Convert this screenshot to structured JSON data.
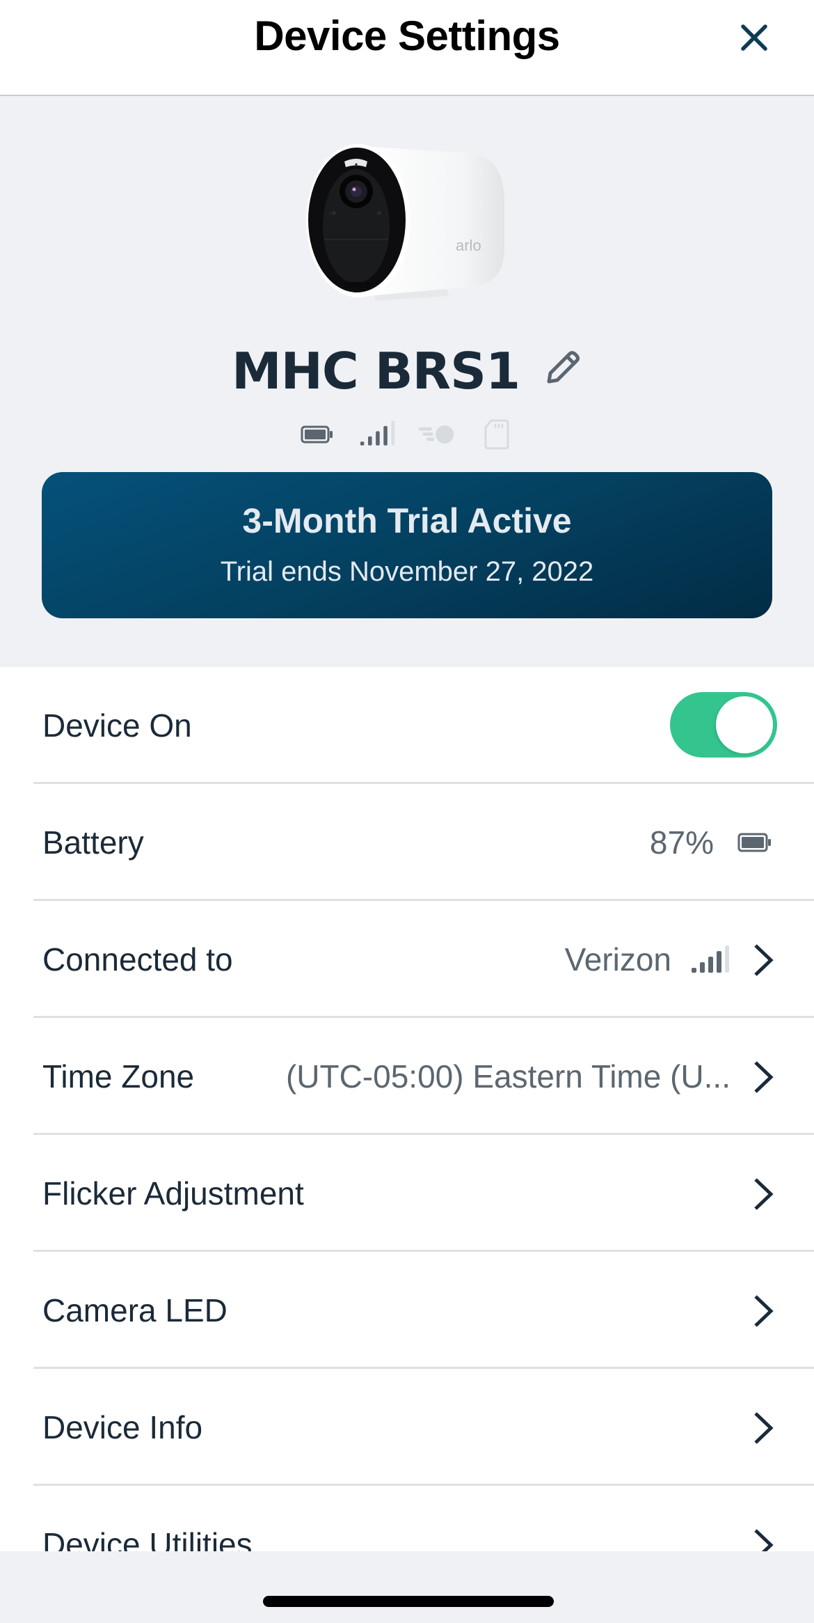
{
  "header": {
    "title": "Device Settings",
    "close_icon": "close-icon"
  },
  "device": {
    "name": "MHC BRS1",
    "image": "arlo-camera-image",
    "brand_mark": "arlo",
    "status_icons": [
      {
        "name": "battery-icon",
        "state": "active"
      },
      {
        "name": "cellular-signal-icon",
        "state": "active",
        "bars": 3,
        "max_bars": 4
      },
      {
        "name": "motion-icon",
        "state": "inactive"
      },
      {
        "name": "sd-card-icon",
        "state": "inactive"
      }
    ]
  },
  "trial": {
    "title": "3-Month Trial Active",
    "subtitle": "Trial ends November 27, 2022"
  },
  "settings": [
    {
      "label": "Device On",
      "type": "toggle",
      "on": true
    },
    {
      "label": "Battery",
      "value": "87%",
      "icon": "battery-icon"
    },
    {
      "label": "Connected to",
      "value": "Verizon",
      "icon": "cellular-signal-icon",
      "signal_bars": 3,
      "signal_max": 4,
      "chevron": true
    },
    {
      "label": "Time Zone",
      "value": "(UTC-05:00) Eastern Time (U...",
      "chevron": true
    },
    {
      "label": "Flicker Adjustment",
      "chevron": true
    },
    {
      "label": "Camera LED",
      "chevron": true
    },
    {
      "label": "Device Info",
      "chevron": true
    },
    {
      "label": "Device Utilities",
      "chevron": true
    }
  ],
  "colors": {
    "toggle_on": "#34c58f",
    "banner_start": "#05517a",
    "banner_end": "#022c45",
    "text_primary": "#1b2a38",
    "text_secondary": "#5b6670",
    "background": "#eff1f4"
  }
}
